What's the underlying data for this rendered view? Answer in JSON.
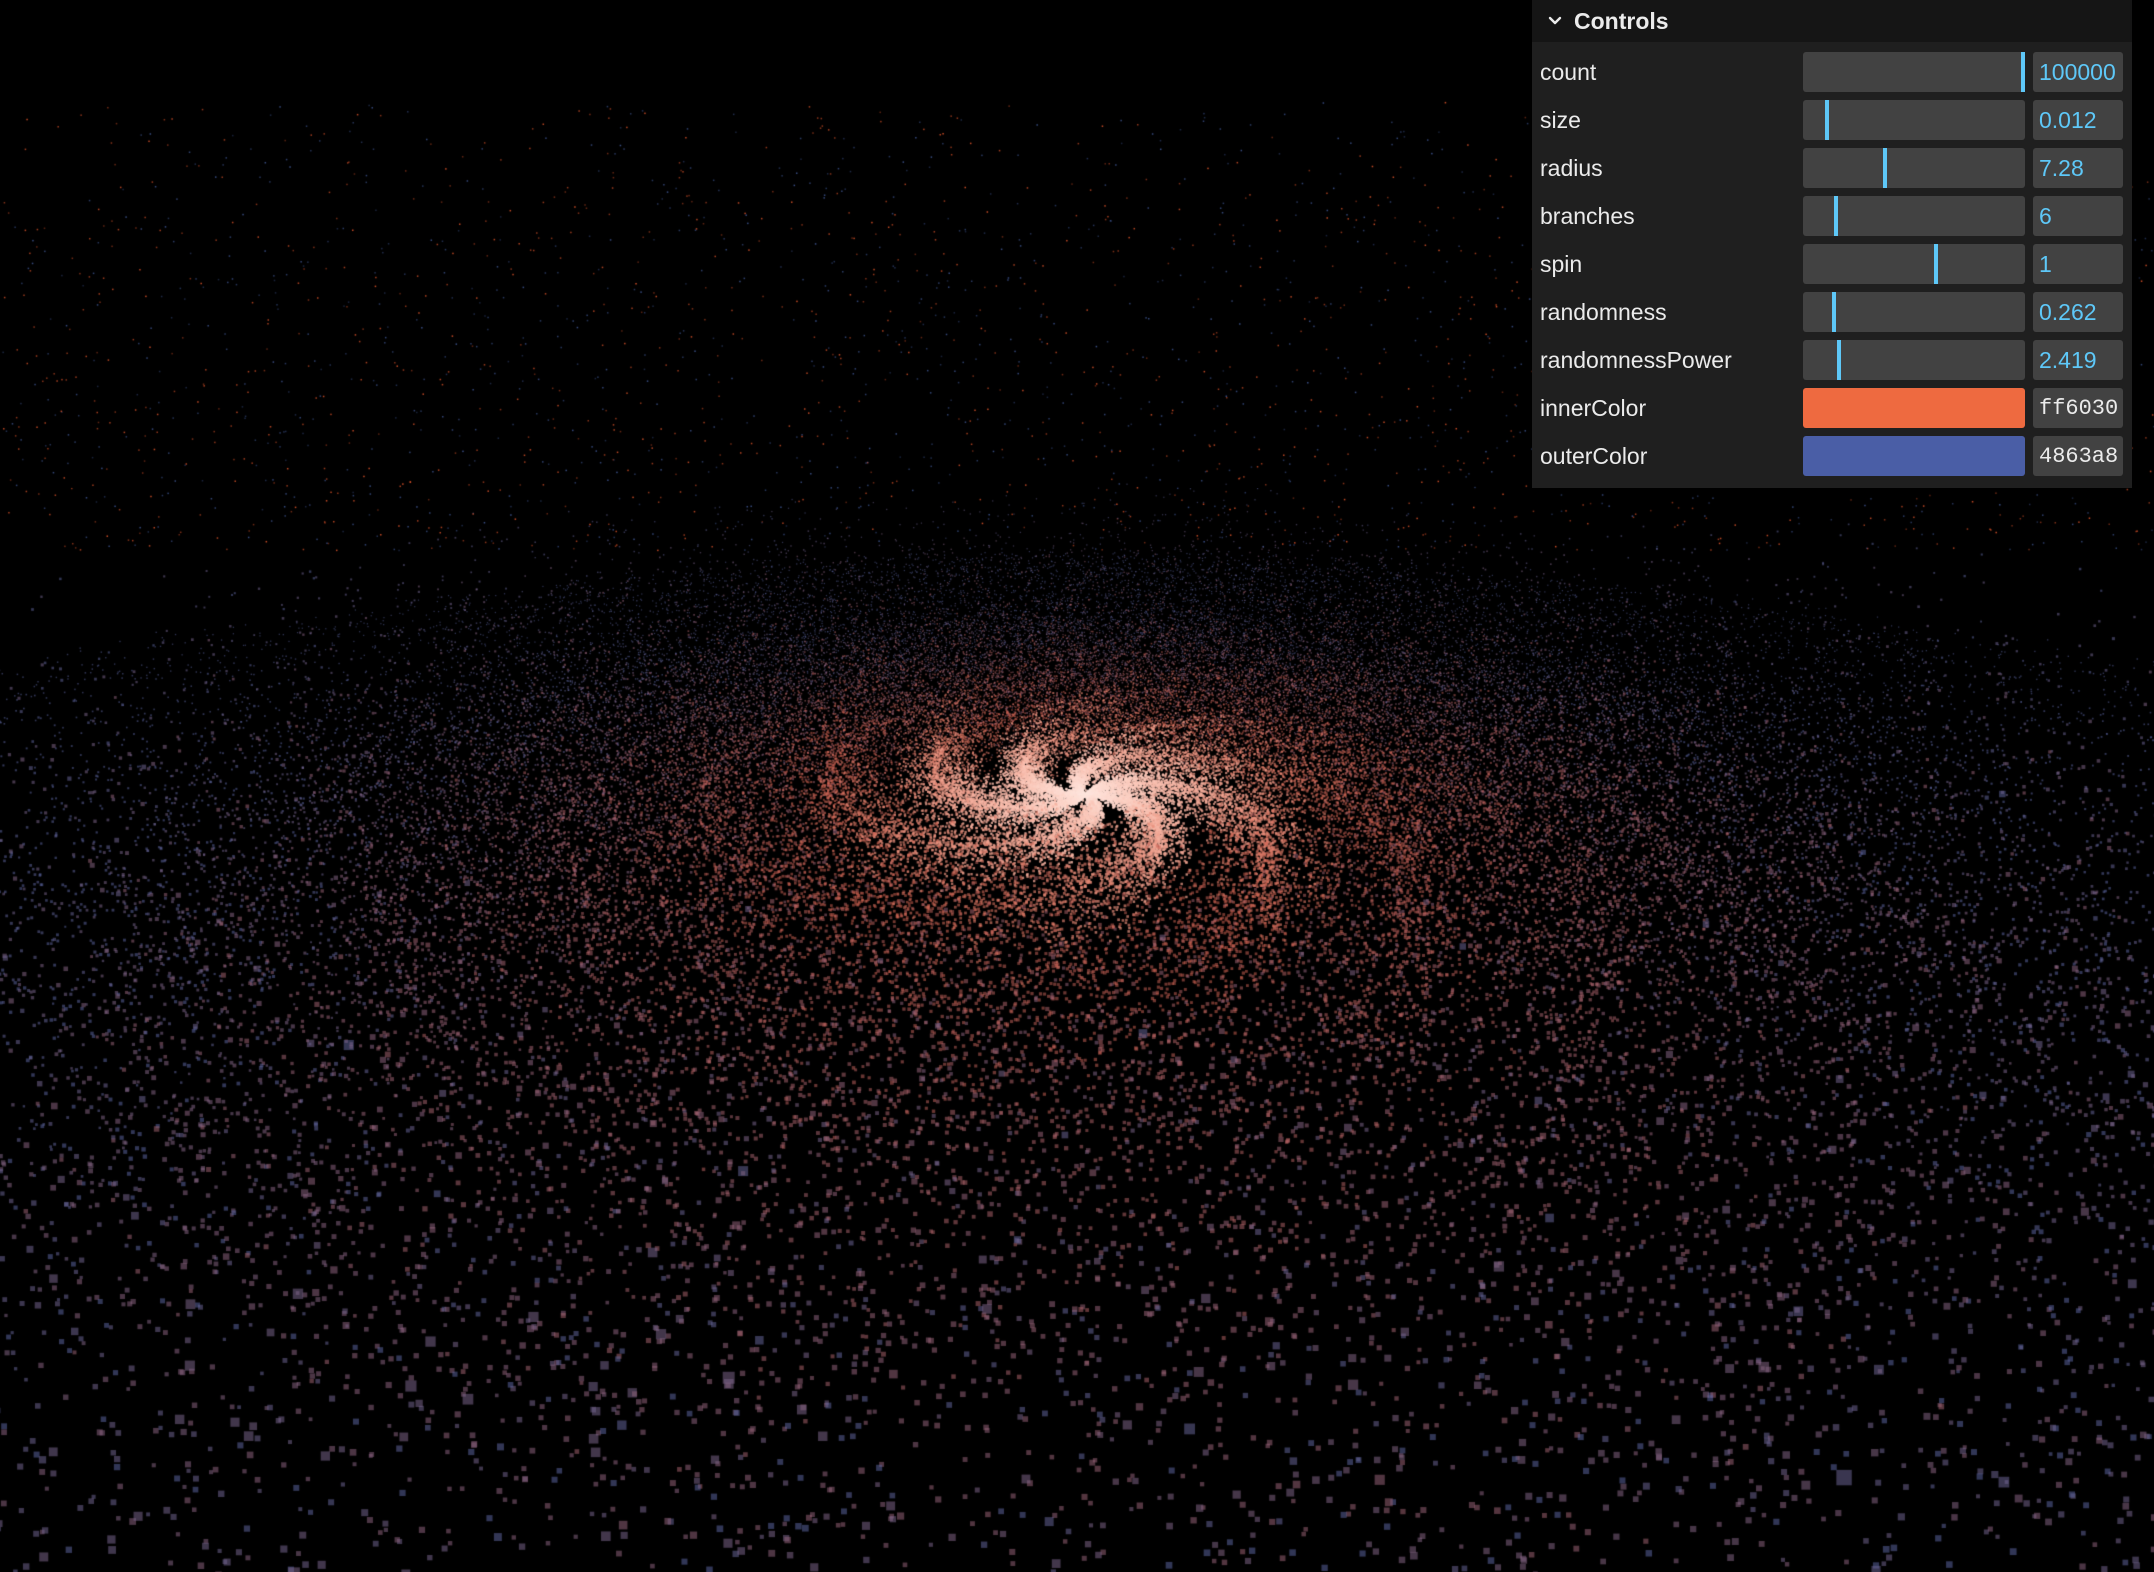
{
  "scene": {
    "background": "#000000"
  },
  "gui": {
    "title": "Controls",
    "toggle_icon": "chevron-down-icon",
    "controls": [
      {
        "key": "count",
        "label": "count",
        "type": "slider",
        "value": "100000",
        "fraction": 1.0
      },
      {
        "key": "size",
        "label": "size",
        "type": "slider",
        "value": "0.012",
        "fraction": 0.11
      },
      {
        "key": "radius",
        "label": "radius",
        "type": "slider",
        "value": "7.28",
        "fraction": 0.37
      },
      {
        "key": "branches",
        "label": "branches",
        "type": "slider",
        "value": "6",
        "fraction": 0.15
      },
      {
        "key": "spin",
        "label": "spin",
        "type": "slider",
        "value": "1",
        "fraction": 0.6
      },
      {
        "key": "randomness",
        "label": "randomness",
        "type": "slider",
        "value": "0.262",
        "fraction": 0.14
      },
      {
        "key": "randomnessPower",
        "label": "randomnessPower",
        "type": "slider",
        "value": "2.419",
        "fraction": 0.16
      },
      {
        "key": "innerColor",
        "label": "innerColor",
        "type": "color",
        "value": "ff6030",
        "color": "#ee6a40"
      },
      {
        "key": "outerColor",
        "label": "outerColor",
        "type": "color",
        "value": "4863a8",
        "color": "#4a5ea6"
      }
    ]
  },
  "colors": {
    "accent": "#5ec8f8",
    "panel_bg": "#1f1f1f",
    "input_bg": "#424242",
    "inner": "#ff6030",
    "outer": "#4863a8"
  }
}
